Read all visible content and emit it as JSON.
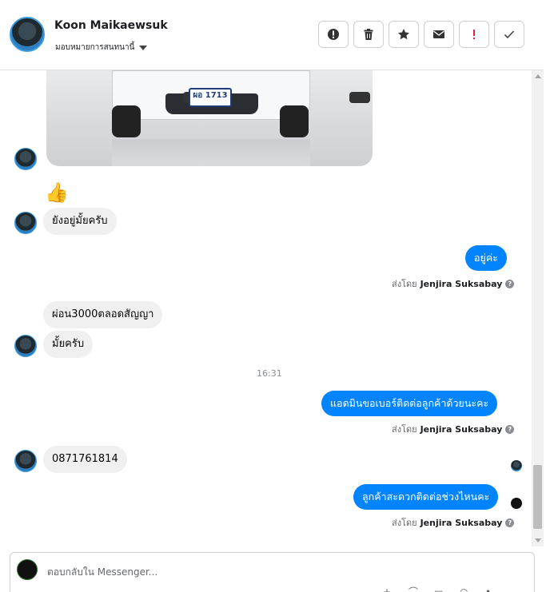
{
  "header": {
    "name": "Koon Maikaewsuk",
    "assign_label": "มอบหมายการสนทนานี้"
  },
  "actions": [
    {
      "name": "spam-icon"
    },
    {
      "name": "trash-icon"
    },
    {
      "name": "star-icon"
    },
    {
      "name": "mail-icon"
    },
    {
      "name": "exclamation-icon"
    },
    {
      "name": "check-icon"
    }
  ],
  "image": {
    "plate_text": "ผอ 1713"
  },
  "messages": {
    "emoji": "👍",
    "in1": "ยังอยู่มั้ยครับ",
    "out1": "อยู่ค่ะ",
    "in2": "ผ่อน3000ตลอดสัญญา",
    "in3": "มั้ยครับ",
    "timestamp": "16:31",
    "out2": "แอดมินขอเบอร์ติดต่อลูกค้าด้วยนะคะ",
    "in4": "0871761814",
    "out3": "ลูกค้าสะดวกติดต่อช่วงไหนคะ"
  },
  "sent_by": {
    "prefix": "ส่งโดย",
    "name": "Jenjira Suksabay"
  },
  "composer": {
    "placeholder": "ตอบกลับใน Messenger..."
  },
  "colors": {
    "outgoing_bubble": "#0084ff",
    "incoming_bubble": "#f0f0f0"
  }
}
